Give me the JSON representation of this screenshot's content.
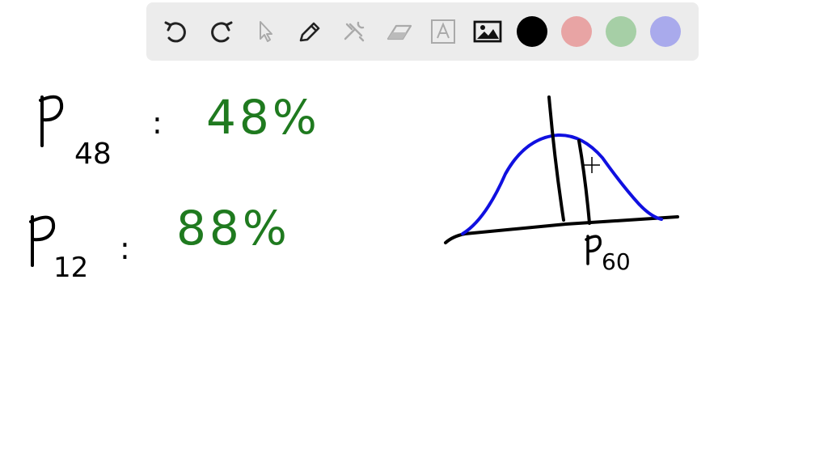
{
  "toolbar": {
    "tools": [
      {
        "icon": "undo-icon",
        "enabled": true
      },
      {
        "icon": "redo-icon",
        "enabled": true
      },
      {
        "icon": "select-pointer-icon",
        "enabled": false
      },
      {
        "icon": "pen-icon",
        "enabled": true
      },
      {
        "icon": "tools-icon",
        "enabled": false
      },
      {
        "icon": "eraser-icon",
        "enabled": false
      },
      {
        "icon": "text-box-icon",
        "enabled": false
      },
      {
        "icon": "image-icon",
        "enabled": true
      }
    ],
    "colors": [
      {
        "name": "black",
        "hex": "#000000",
        "selected": true
      },
      {
        "name": "red",
        "hex": "#e8a4a4",
        "selected": false
      },
      {
        "name": "green",
        "hex": "#a6cfa6",
        "selected": false
      },
      {
        "name": "blue",
        "hex": "#a9aaec",
        "selected": false
      }
    ]
  },
  "notes": {
    "line1": {
      "symbol": "P",
      "subscript": "48",
      "separator": ":",
      "value": "48%"
    },
    "line2": {
      "symbol": "P",
      "subscript": "12",
      "separator": ":",
      "value": "88%"
    },
    "graph_label": {
      "symbol": "P",
      "subscript": "60"
    }
  },
  "ink_colors": {
    "black": "#000000",
    "green": "#1f7a1f",
    "blue": "#1010e0"
  }
}
